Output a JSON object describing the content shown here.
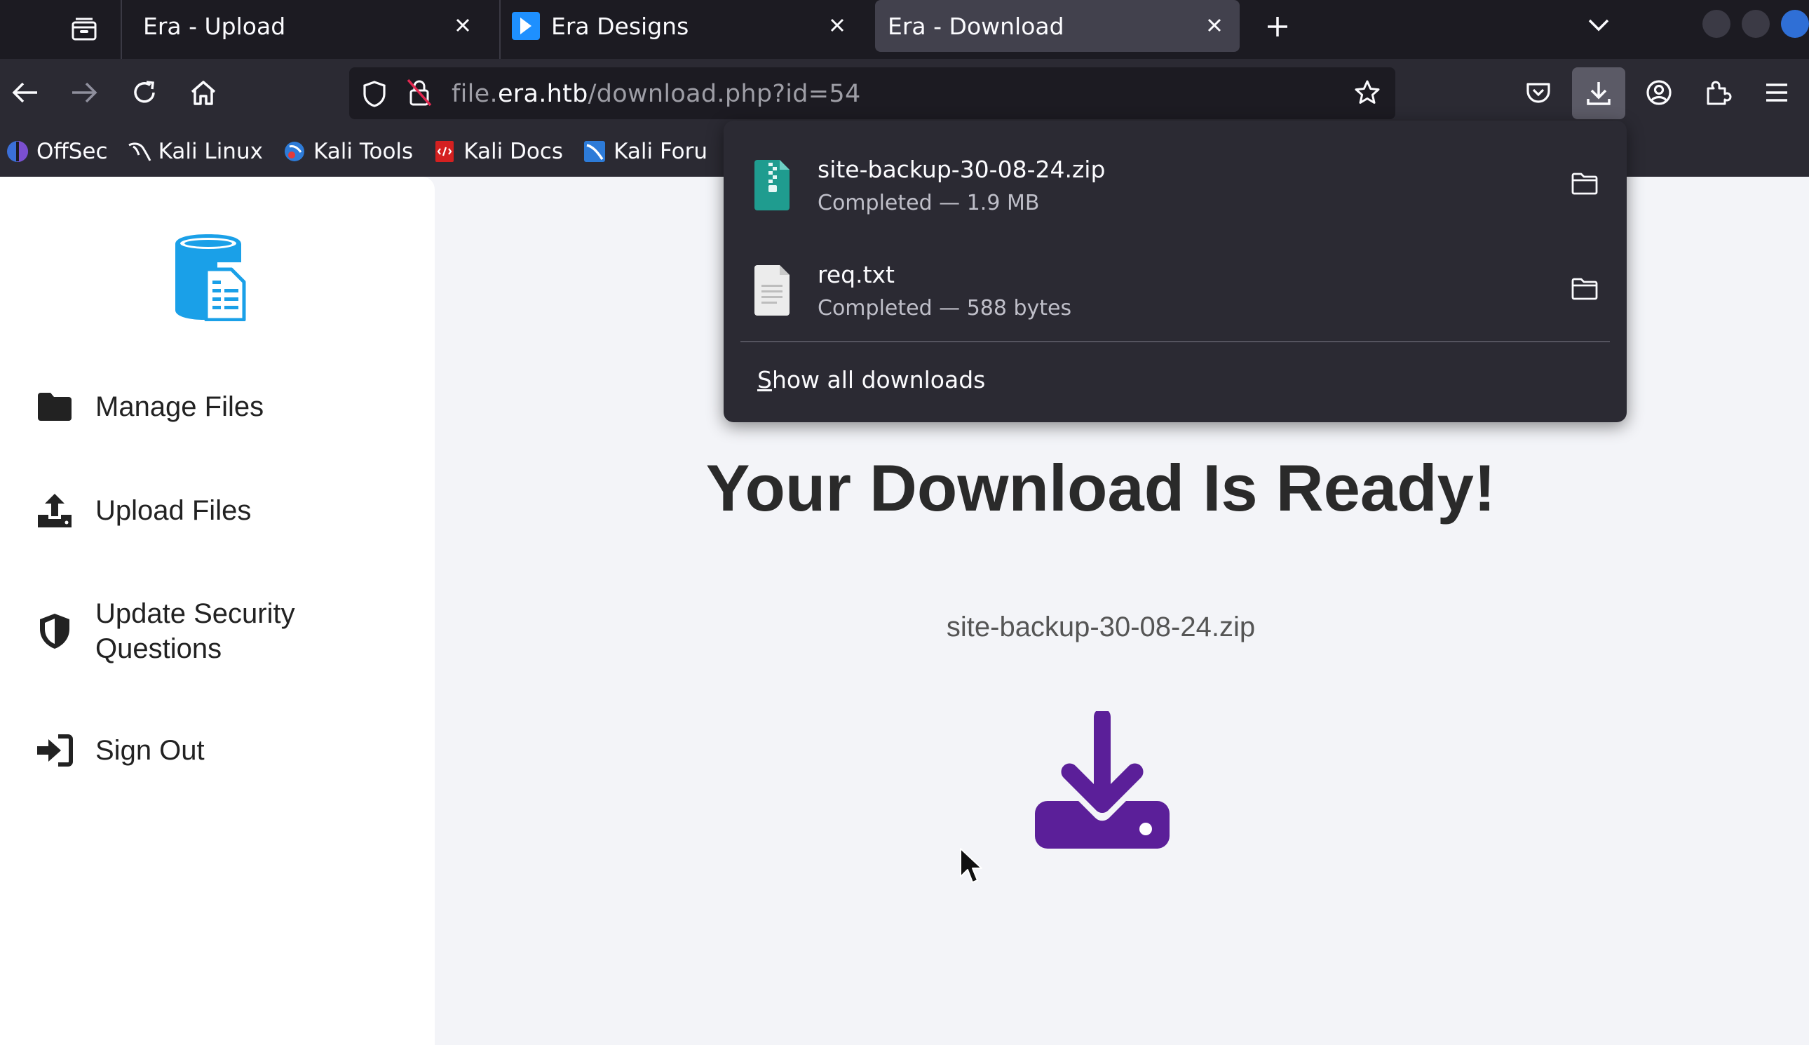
{
  "tabs": [
    {
      "title": "Era - Upload"
    },
    {
      "title": "Era Designs"
    },
    {
      "title": "Era - Download",
      "active": true
    }
  ],
  "toolbar": {
    "url_host_prefix": "file.",
    "url_host": "era.htb",
    "url_path": "/download.php?id=54"
  },
  "bookmarks": [
    {
      "label": "OffSec",
      "icon": "offsec-icon"
    },
    {
      "label": "Kali Linux",
      "icon": "kali-dragon-icon"
    },
    {
      "label": "Kali Tools",
      "icon": "kali-tools-icon"
    },
    {
      "label": "Kali Docs",
      "icon": "kali-docs-icon"
    },
    {
      "label": "Kali Foru",
      "icon": "kali-forums-icon"
    }
  ],
  "downloads_panel": {
    "items": [
      {
        "name": "site-backup-30-08-24.zip",
        "status": "Completed — 1.9 MB",
        "icon": "zip-file-icon"
      },
      {
        "name": "req.txt",
        "status": "Completed — 588 bytes",
        "icon": "text-file-icon"
      }
    ],
    "show_all_prefix": "S",
    "show_all_rest": "how all downloads"
  },
  "sidebar": {
    "items": [
      {
        "label": "Manage Files",
        "icon": "folder-icon"
      },
      {
        "label": "Upload Files",
        "icon": "upload-icon"
      },
      {
        "label_line1": "Update Security",
        "label_line2": "Questions",
        "icon": "shield-icon"
      },
      {
        "label": "Sign Out",
        "icon": "sign-out-icon"
      }
    ]
  },
  "main": {
    "headline": "Your Download Is Ready!",
    "filename": "site-backup-30-08-24.zip"
  },
  "colors": {
    "accent_download": "#5b1f99",
    "logo_blue": "#1aa0e8",
    "chrome_dark": "#1c1b22",
    "toolbar": "#2b2a33"
  }
}
